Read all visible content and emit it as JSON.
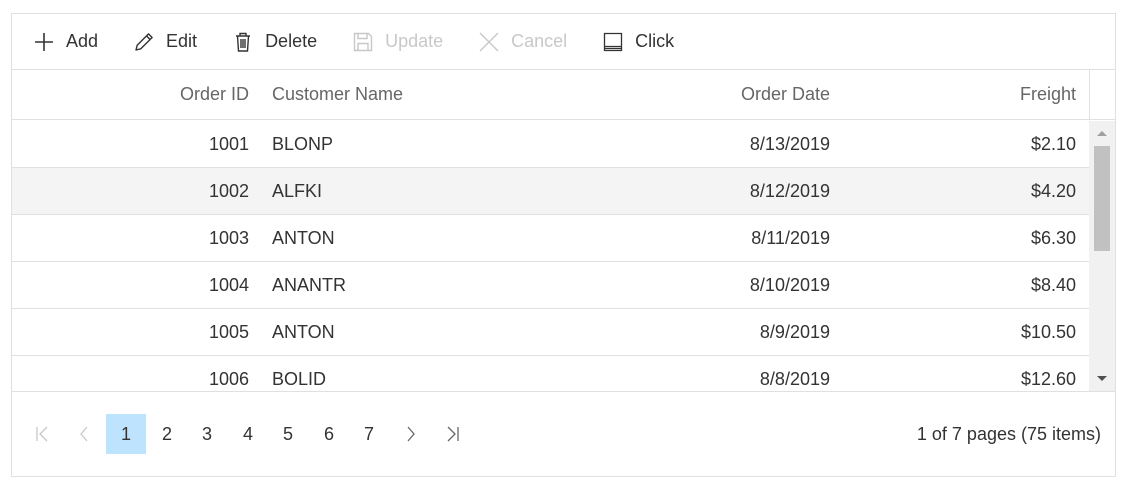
{
  "toolbar": {
    "add": "Add",
    "edit": "Edit",
    "delete": "Delete",
    "update": "Update",
    "cancel": "Cancel",
    "click": "Click"
  },
  "columns": {
    "order_id": "Order ID",
    "customer_name": "Customer Name",
    "order_date": "Order Date",
    "freight": "Freight"
  },
  "rows": [
    {
      "order_id": "1001",
      "customer_name": "BLONP",
      "order_date": "8/13/2019",
      "freight": "$2.10"
    },
    {
      "order_id": "1002",
      "customer_name": "ALFKI",
      "order_date": "8/12/2019",
      "freight": "$4.20"
    },
    {
      "order_id": "1003",
      "customer_name": "ANTON",
      "order_date": "8/11/2019",
      "freight": "$6.30"
    },
    {
      "order_id": "1004",
      "customer_name": "ANANTR",
      "order_date": "8/10/2019",
      "freight": "$8.40"
    },
    {
      "order_id": "1005",
      "customer_name": "ANTON",
      "order_date": "8/9/2019",
      "freight": "$10.50"
    },
    {
      "order_id": "1006",
      "customer_name": "BOLID",
      "order_date": "8/8/2019",
      "freight": "$12.60"
    }
  ],
  "pager": {
    "pages": [
      "1",
      "2",
      "3",
      "4",
      "5",
      "6",
      "7"
    ],
    "current": "1",
    "info": "1 of 7 pages (75 items)"
  },
  "colors": {
    "accent_active_page": "#bee3ff",
    "alt_row": "#f4f4f4",
    "border": "#e0e0e0",
    "disabled_text": "#c8c8c8"
  },
  "icons": {
    "add": "plus-icon",
    "edit": "pencil-icon",
    "delete": "trash-icon",
    "update": "save-icon",
    "cancel": "close-icon",
    "click": "window-icon"
  }
}
